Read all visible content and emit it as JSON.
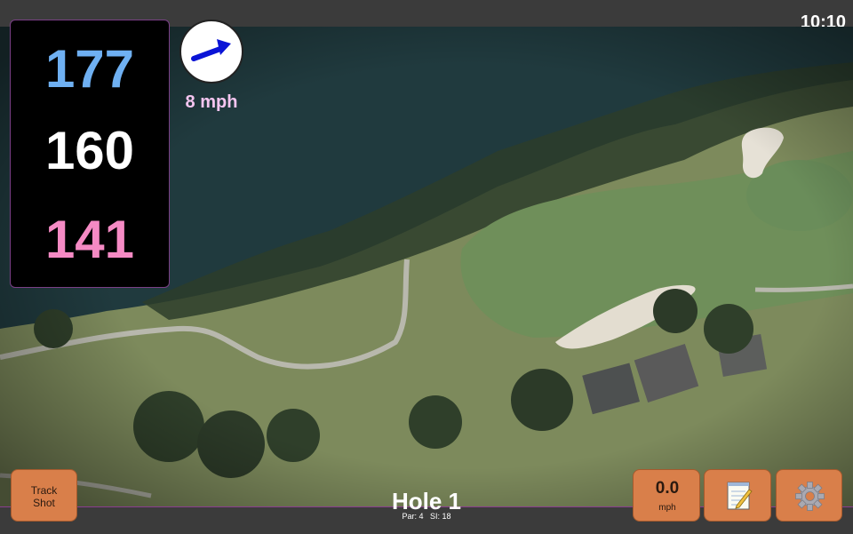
{
  "status": {
    "time": "10:10"
  },
  "distances": {
    "back": "177",
    "middle": "160",
    "front": "141"
  },
  "wind": {
    "speed": "8 mph",
    "arrow_icon": "wind-arrow-icon",
    "arrow_color": "#0a14d6"
  },
  "hole": {
    "title": "Hole 1",
    "par_label": "Par: 4",
    "si_label": "SI: 18"
  },
  "buttons": {
    "track_shot": "Track\nShot",
    "speed_value": "0.0",
    "speed_unit": "mph",
    "notes_icon": "notepad-icon",
    "settings_icon": "gear-icon"
  },
  "colors": {
    "accent_border": "#8a3d8f",
    "button_bg": "#d97f4a",
    "back_distance": "#6fb0f2",
    "front_distance": "#f58ac4"
  }
}
